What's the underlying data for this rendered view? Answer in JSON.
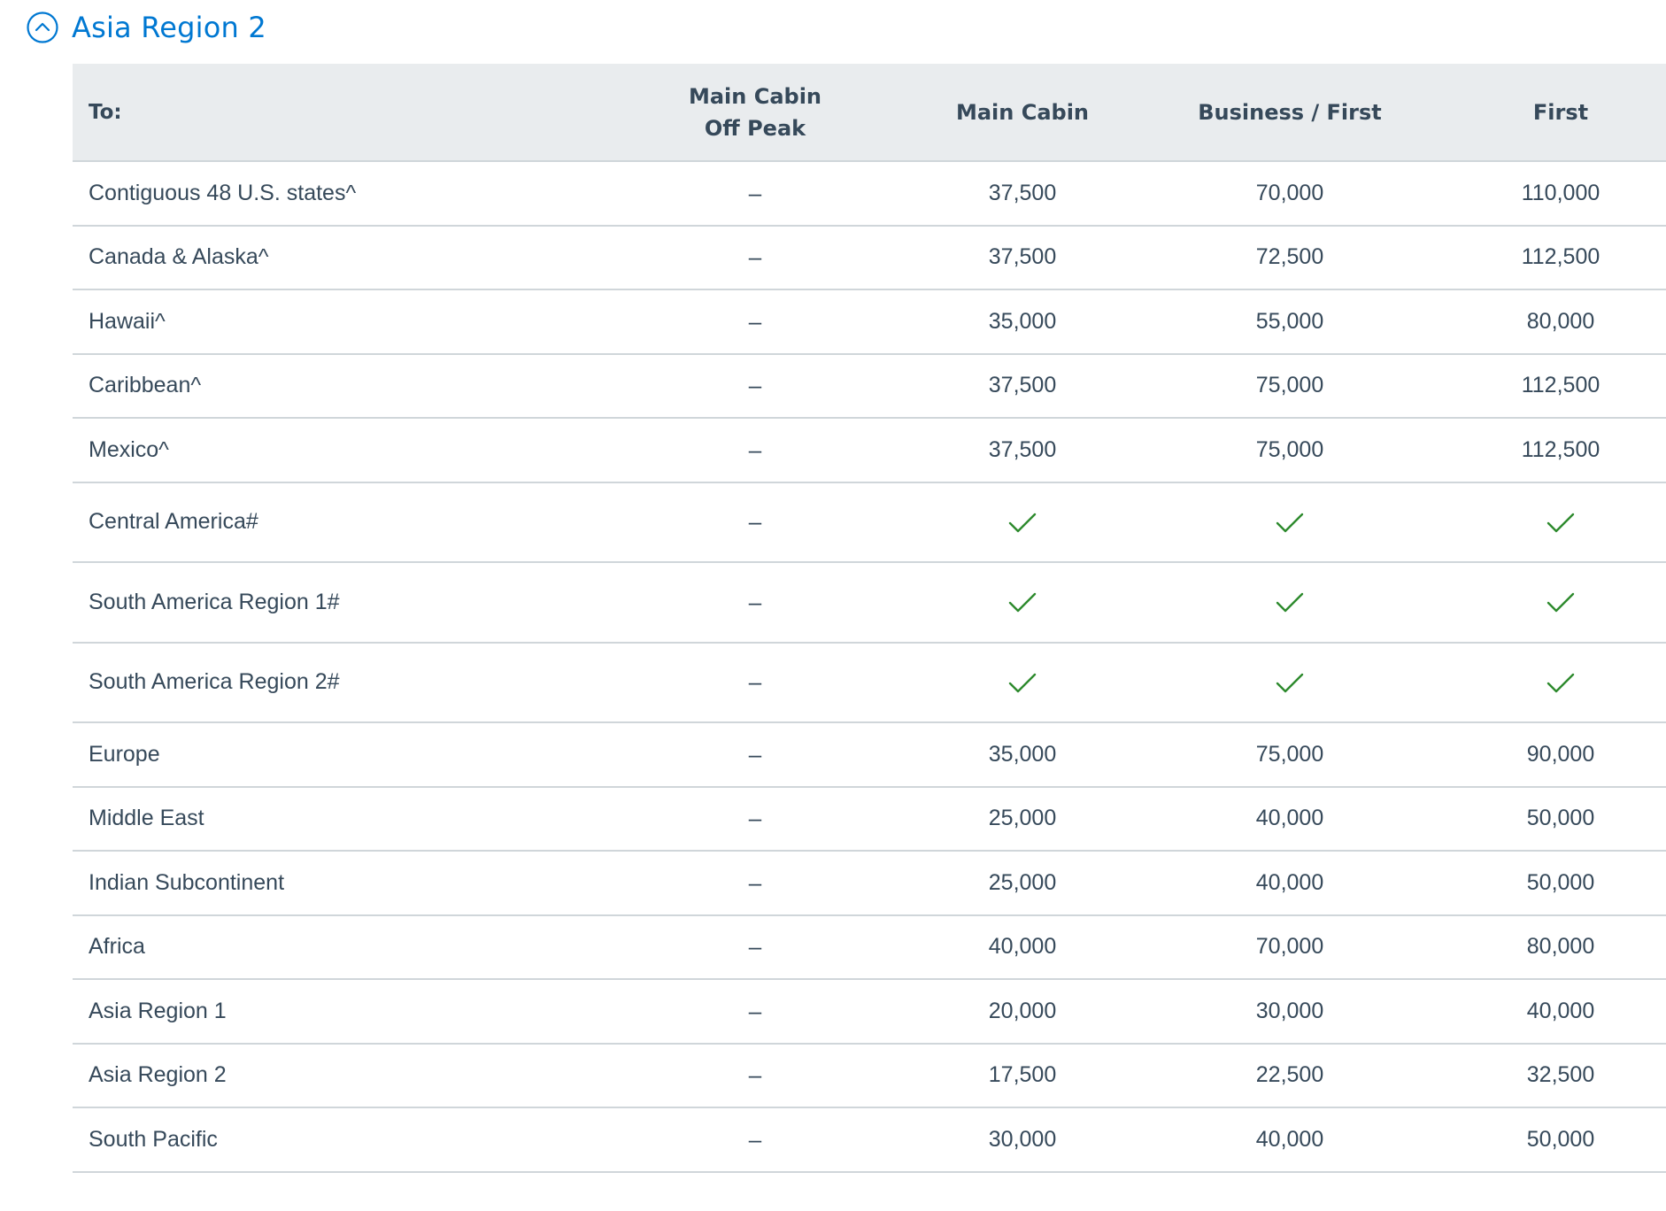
{
  "section": {
    "title": "Asia Region 2",
    "toggle_icon": "chevron-up-circle-icon",
    "accent_color": "#0078d2"
  },
  "table": {
    "columns": [
      {
        "key": "to",
        "label_lines": [
          "To:"
        ]
      },
      {
        "key": "main_cabin_off_peak",
        "label_lines": [
          "Main Cabin",
          "Off Peak"
        ]
      },
      {
        "key": "main_cabin",
        "label_lines": [
          "Main Cabin"
        ]
      },
      {
        "key": "business_first",
        "label_lines": [
          "Business / First"
        ]
      },
      {
        "key": "first",
        "label_lines": [
          "First"
        ]
      }
    ],
    "check_icon": "checkmark-icon",
    "check_color": "#2d8a2d",
    "header_bg": "#e9ecee",
    "rows": [
      {
        "destination": "Contiguous 48 U.S. states^",
        "main_cabin_off_peak": "–",
        "main_cabin": "37,500",
        "business_first": "70,000",
        "first": "110,000"
      },
      {
        "destination": "Canada & Alaska^",
        "main_cabin_off_peak": "–",
        "main_cabin": "37,500",
        "business_first": "72,500",
        "first": "112,500"
      },
      {
        "destination": "Hawaii^",
        "main_cabin_off_peak": "–",
        "main_cabin": "35,000",
        "business_first": "55,000",
        "first": "80,000"
      },
      {
        "destination": "Caribbean^",
        "main_cabin_off_peak": "–",
        "main_cabin": "37,500",
        "business_first": "75,000",
        "first": "112,500"
      },
      {
        "destination": "Mexico^",
        "main_cabin_off_peak": "–",
        "main_cabin": "37,500",
        "business_first": "75,000",
        "first": "112,500"
      },
      {
        "destination": "Central America#",
        "main_cabin_off_peak": "–",
        "main_cabin": "check",
        "business_first": "check",
        "first": "check"
      },
      {
        "destination": "South America Region 1#",
        "main_cabin_off_peak": "–",
        "main_cabin": "check",
        "business_first": "check",
        "first": "check"
      },
      {
        "destination": "South America Region 2#",
        "main_cabin_off_peak": "–",
        "main_cabin": "check",
        "business_first": "check",
        "first": "check"
      },
      {
        "destination": "Europe",
        "main_cabin_off_peak": "–",
        "main_cabin": "35,000",
        "business_first": "75,000",
        "first": "90,000"
      },
      {
        "destination": "Middle East",
        "main_cabin_off_peak": "–",
        "main_cabin": "25,000",
        "business_first": "40,000",
        "first": "50,000"
      },
      {
        "destination": "Indian Subcontinent",
        "main_cabin_off_peak": "–",
        "main_cabin": "25,000",
        "business_first": "40,000",
        "first": "50,000"
      },
      {
        "destination": "Africa",
        "main_cabin_off_peak": "–",
        "main_cabin": "40,000",
        "business_first": "70,000",
        "first": "80,000"
      },
      {
        "destination": "Asia Region 1",
        "main_cabin_off_peak": "–",
        "main_cabin": "20,000",
        "business_first": "30,000",
        "first": "40,000"
      },
      {
        "destination": "Asia Region 2",
        "main_cabin_off_peak": "–",
        "main_cabin": "17,500",
        "business_first": "22,500",
        "first": "32,500"
      },
      {
        "destination": "South Pacific",
        "main_cabin_off_peak": "–",
        "main_cabin": "30,000",
        "business_first": "40,000",
        "first": "50,000"
      }
    ]
  }
}
